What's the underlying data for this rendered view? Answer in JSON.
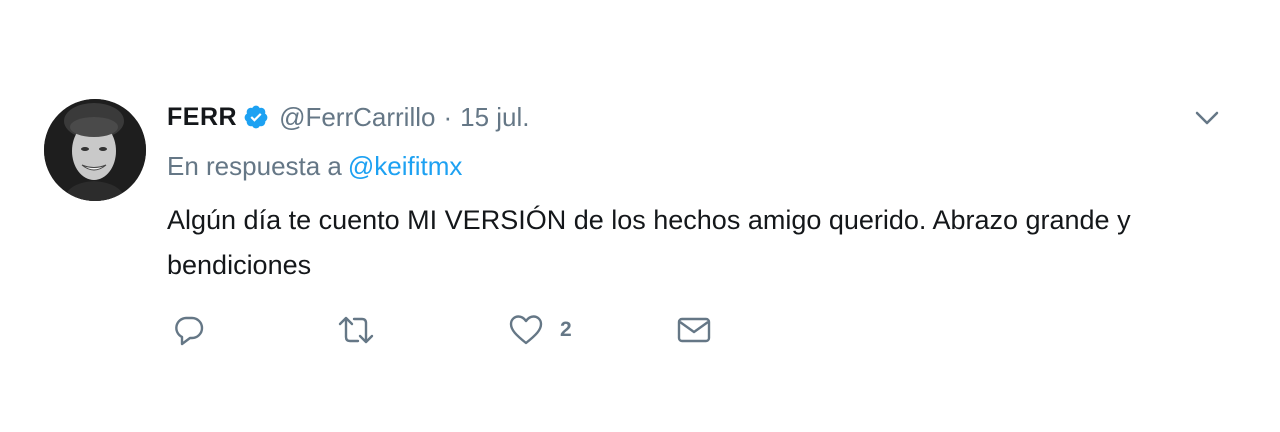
{
  "tweet": {
    "author_name": "FERR",
    "handle": "@FerrCarrillo",
    "separator": "·",
    "date": "15 jul.",
    "reply_prefix": "En respuesta a",
    "reply_mention": "@keifitmx",
    "text": "Algún día te cuento MI VERSIÓN de los hechos amigo querido. Abrazo grande y bendiciones"
  },
  "actions": {
    "reply_icon": "reply-icon",
    "retweet_icon": "retweet-icon",
    "like_icon": "heart-icon",
    "like_count": "2",
    "dm_icon": "envelope-icon"
  },
  "colors": {
    "text": "#14171a",
    "secondary": "#657786",
    "link": "#1da1f2",
    "verified": "#1da1f2"
  }
}
